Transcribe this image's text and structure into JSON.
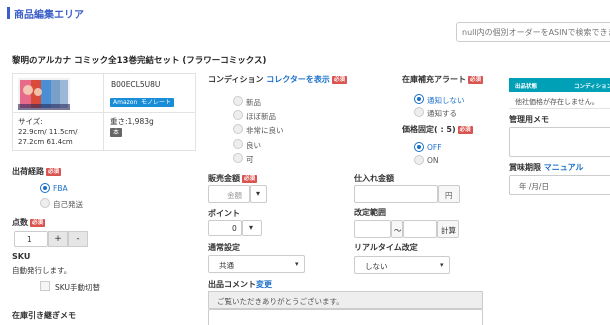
{
  "header": {
    "title": "商品編集エリア"
  },
  "search": {
    "placeholder": "null内の個別オーダーをASINで検索できます"
  },
  "product": {
    "title": "黎明のアルカナ コミック全13巻完結セット (フラワーコミックス)",
    "asin": "B00ECL5U8U",
    "badge_amazon": "Amazon",
    "badge_monorate": "モノレート",
    "size_label": "サイズ:",
    "size_value": "22.9cm/ 11.5cm/ 27.2cm 61.4cm",
    "weight_label": "重さ:1,983g",
    "category_badge": "本"
  },
  "shipping": {
    "label": "出荷経路",
    "required": "必須",
    "options": [
      "FBA",
      "自己発送"
    ],
    "selected_index": 0
  },
  "quantity": {
    "label": "点数",
    "required": "必須",
    "value": "1",
    "plus": "+",
    "minus": "-"
  },
  "sku": {
    "label": "SKU",
    "auto_text": "自動発行します。",
    "manual_checkbox_label": "SKU手動切替"
  },
  "handover_memo": {
    "label": "在庫引き継ぎメモ"
  },
  "condition": {
    "label": "コンディション",
    "link": "コレクターを表示",
    "required": "必須",
    "options": [
      "新品",
      "ほぼ新品",
      "非常に良い",
      "良い",
      "可"
    ]
  },
  "price": {
    "label": "販売金額",
    "required": "必須",
    "placeholder": "金額",
    "dropdown_glyph": "▾"
  },
  "points": {
    "label": "ポイント",
    "value": "0",
    "dropdown_glyph": "▾"
  },
  "shipping_setting": {
    "label": "通常設定",
    "value": "共通"
  },
  "comment": {
    "label": "出品コメント",
    "link": "変更",
    "value": "ご覧いただきありがとうございます。"
  },
  "purchase_price": {
    "label": "仕入れ金額",
    "unit": "円"
  },
  "range": {
    "label": "改定範囲",
    "separator": "〜",
    "calc_button": "計算"
  },
  "realtime": {
    "label": "リアルタイム改定",
    "value": "しない"
  },
  "restock_alert": {
    "label": "在庫補充アラート",
    "required": "必須",
    "options": [
      "通知しない",
      "通知する"
    ],
    "selected_index": 0
  },
  "price_lock": {
    "label": "価格固定( : 5)",
    "required": "必須",
    "options": [
      "OFF",
      "ON"
    ],
    "selected_index": 0
  },
  "competitor_table": {
    "headers": [
      "出品状態",
      "コンディション"
    ],
    "empty_text": "他社価格が存在しません。"
  },
  "admin_memo": {
    "label": "管理用メモ"
  },
  "expiry": {
    "label": "賞味期限",
    "link": "マニュアル",
    "placeholder": "年 /月/日"
  },
  "colors": {
    "accent": "#3b5fc9",
    "link": "#1a6fc9",
    "required": "#d9534f",
    "teal": "#00a0b7"
  }
}
